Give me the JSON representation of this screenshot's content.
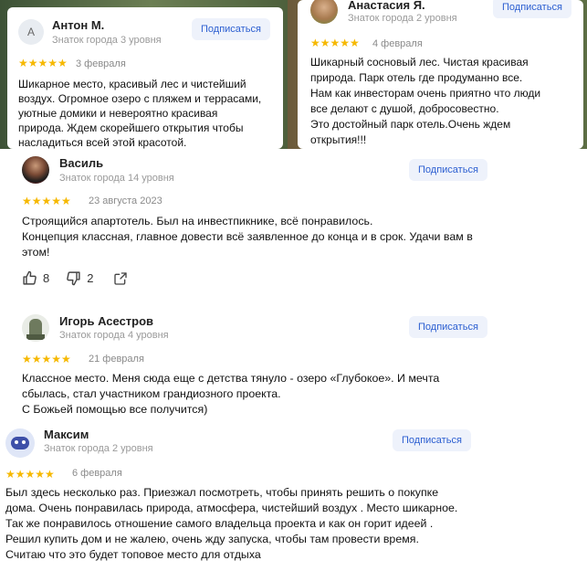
{
  "reviews_top": [
    {
      "avatar_letter": "А",
      "name": "Антон М.",
      "level": "Знаток города 3 уровня",
      "subscribe": "Подписаться",
      "stars": "★★★★★",
      "date": "3 февраля",
      "lines": [
        "Шикарное место, красивый лес и чистейший",
        "воздух. Огромное озеро с пляжем и террасами,",
        "уютные домики и невероятно красивая",
        "природа. Ждем скорейшего открытия чтобы",
        "насладиться всей этой красотой."
      ]
    },
    {
      "name": "Анастасия Я.",
      "level": "Знаток города 2 уровня",
      "subscribe": "Подписаться",
      "stars": "★★★★★",
      "date": "4 февраля",
      "lines": [
        "Шикарный сосновый лес. Чистая красивая",
        "природа. Парк отель где продуманно все.",
        "Нам как инвесторам очень приятно что люди",
        "все делают с душой, добросовестно.",
        "Это достойный парк отель.Очень ждем",
        "открытия!!!"
      ]
    }
  ],
  "reviews": [
    {
      "name": "Василь",
      "level": "Знаток города 14 уровня",
      "subscribe": "Подписаться",
      "stars": "★★★★★",
      "date": "23 августа 2023",
      "lines": [
        "Строящийся апартотель. Был на инвестпикнике, всё понравилось.",
        "Концепция классная, главное довести всё заявленное до конца и в срок. Удачи вам в",
        "этом!"
      ],
      "likes": "8",
      "dislikes": "2"
    },
    {
      "name": "Игорь Асестров",
      "level": "Знаток города 4 уровня",
      "subscribe": "Подписаться",
      "stars": "★★★★★",
      "date": "21 февраля",
      "lines": [
        "Классное место. Меня сюда еще с детства тянуло - озеро «Глубокое». И мечта",
        "сбылась, стал участником грандиозного проекта.",
        "С Божьей помощью все получится)"
      ]
    },
    {
      "name": "Максим",
      "level": "Знаток города 2 уровня",
      "subscribe": "Подписаться",
      "stars": "★★★★★",
      "date": "6 февраля",
      "lines": [
        "Был здесь несколько раз. Приезжал посмотреть, чтобы принять решить о покупке",
        "дома. Очень понравилась природа, атмосфера, чистейший воздух . Место шикарное.",
        "Так же понравилось отношение самого владельца проекта и как он горит идеей .",
        "Решил купить дом и не жалею, очень жду запуска, чтобы там провести время.",
        "Считаю что это будет топовое место для отдыха"
      ]
    }
  ],
  "colors": {
    "star": "#f6b800",
    "subscribe_bg": "#eef2fb",
    "subscribe_text": "#2c5fd1"
  }
}
